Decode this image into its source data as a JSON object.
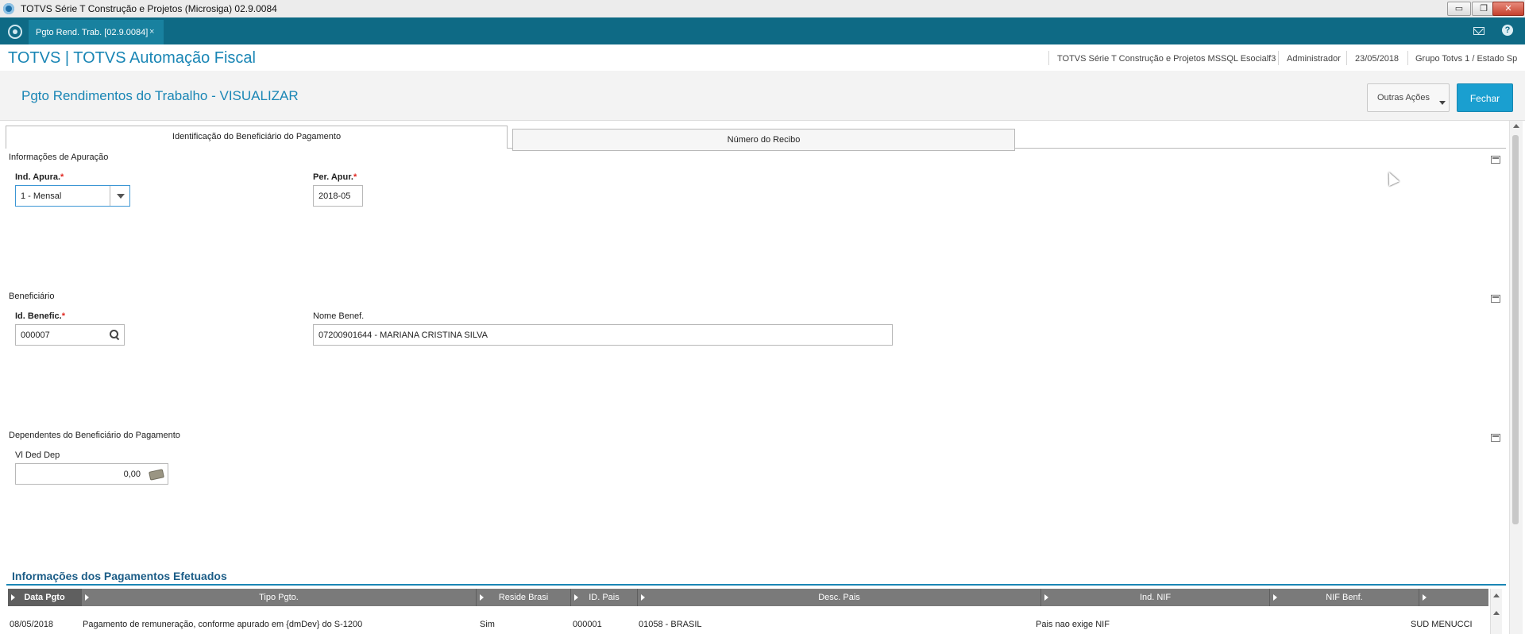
{
  "window": {
    "title": "TOTVS Série T Construção e Projetos (Microsiga) 02.9.0084",
    "minimize_glyph": "▭",
    "restore_glyph": "❐",
    "close_glyph": "✕"
  },
  "tabs": {
    "active_label": "Pgto Rend. Trab. [02.9.0084]",
    "close_glyph": "×",
    "help_glyph": "?"
  },
  "brand": {
    "name": "TOTVS | TOTVS Automação Fiscal",
    "environment": "TOTVS Série T Construção e Projetos MSSQL Esocialf3",
    "user": "Administrador",
    "date": "23/05/2018",
    "company": "Grupo Totvs 1 / Estado Sp"
  },
  "page": {
    "title": "Pgto Rendimentos do Trabalho - VISUALIZAR",
    "outras_acoes": "Outras Ações",
    "fechar": "Fechar"
  },
  "form_tabs": {
    "tab1": "Identificação do Beneficiário do Pagamento",
    "tab2": "Número do Recibo"
  },
  "apuracao": {
    "section_title": "Informações de Apuração",
    "ind_apura_label": "Ind. Apura.",
    "ind_apura_value": "1 - Mensal",
    "per_apur_label": "Per. Apur.",
    "per_apur_value": "2018-05",
    "required_mark": "*"
  },
  "beneficiario": {
    "section_title": "Beneficiário",
    "id_label": "Id. Benefic.",
    "id_value": "000007",
    "nome_label": "Nome Benef.",
    "nome_value": "07200901644 - MARIANA CRISTINA SILVA"
  },
  "dependentes": {
    "section_title": "Dependentes do Beneficiário do Pagamento",
    "vl_label": "Vl Ded Dep",
    "vl_value": "0,00"
  },
  "pagamentos": {
    "heading": "Informações dos Pagamentos Efetuados",
    "columns": [
      "Data Pgto",
      "Tipo Pgto.",
      "Reside Brasi",
      "ID. Pais",
      "Desc. Pais",
      "Ind. NIF",
      "NIF Benf.",
      ""
    ],
    "rows": [
      {
        "data": "08/05/2018",
        "tipo": "Pagamento de remuneração, conforme apurado em {dmDev} do S-1200",
        "reside": "Sim",
        "id_pais": "000001",
        "desc_pais": "01058 - BRASIL",
        "ind_nif": "Pais nao exige NIF",
        "nif": "",
        "extra": "SUD MENUCCI"
      }
    ]
  },
  "colors": {
    "teal_bar": "#0e6a85",
    "accent": "#1a86b5",
    "button_primary": "#1a9fd0",
    "grid_header": "#7a7a7a"
  }
}
